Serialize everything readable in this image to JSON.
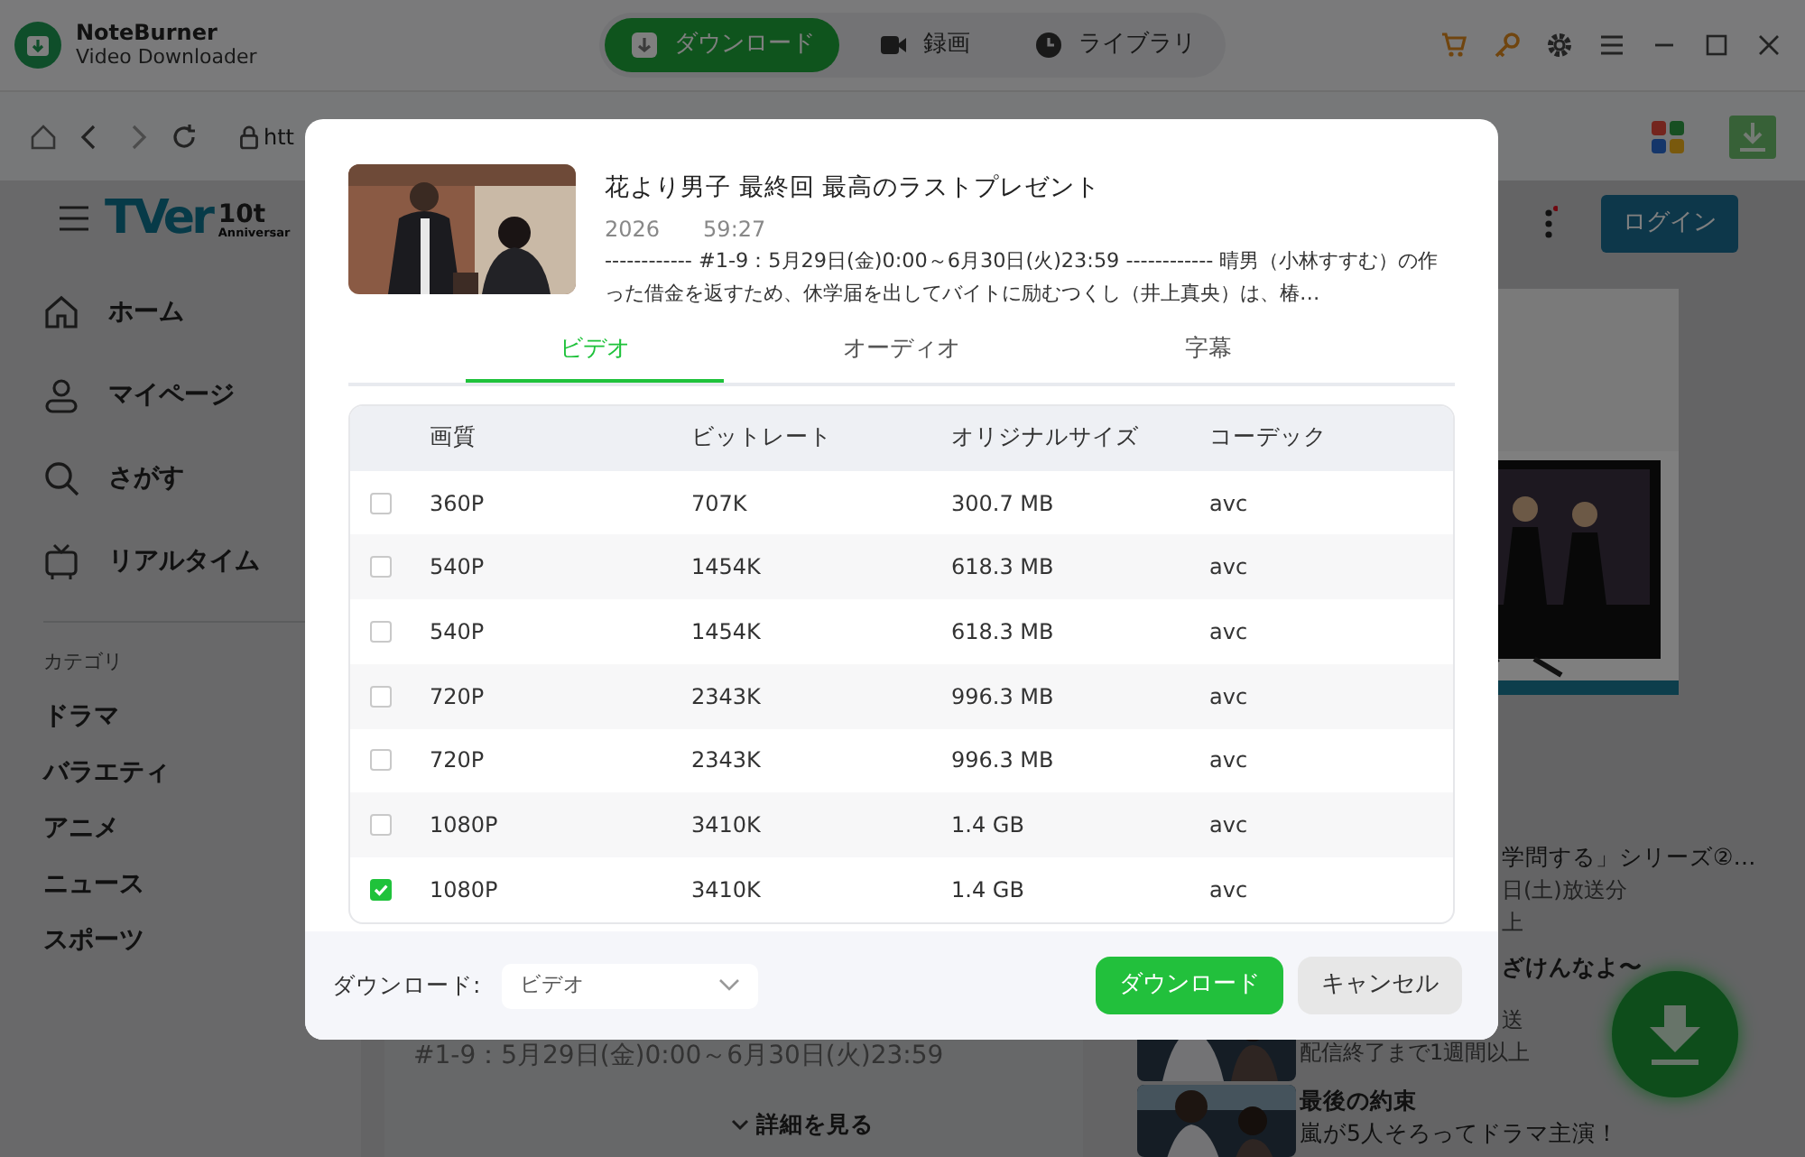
{
  "app": {
    "name": "NoteBurner",
    "subtitle": "Video Downloader",
    "tabs": [
      {
        "label": "ダウンロード",
        "selected": true
      },
      {
        "label": "録画",
        "selected": false
      },
      {
        "label": "ライブラリ",
        "selected": false
      }
    ]
  },
  "address_bar": {
    "url": "htt"
  },
  "site": {
    "logo": "TVer",
    "logo_badge": "10t",
    "logo_caption": "Anniversar",
    "nav": [
      "ホーム",
      "マイページ",
      "さがす",
      "リアルタイム"
    ],
    "category_heading": "カテゴリ",
    "categories": [
      "ドラマ",
      "バラエティ",
      "アニメ",
      "ニュース",
      "スポーツ"
    ],
    "login": "ログイン",
    "episode_period": "#1-9：5月29日(金)0:00～6月30日(火)23:59",
    "details_link": "詳細を見る",
    "side_list": [
      {
        "lines": [
          {
            "text": "学問する」シリーズ②…",
            "kind": "text"
          },
          {
            "text": "日(土)放送分",
            "kind": "note"
          },
          {
            "text": "上",
            "kind": "note"
          }
        ]
      },
      {
        "lines": [
          {
            "text": "ざけんなよ〜",
            "kind": "heading"
          },
          {
            "text": "送",
            "kind": "note"
          },
          {
            "text": "配信終了まで1週間以上",
            "kind": "note"
          }
        ]
      },
      {
        "lines": [
          {
            "text": "最後の約束",
            "kind": "heading"
          },
          {
            "text": "嵐が5人そろってドラマ主演！",
            "kind": "text"
          }
        ]
      }
    ]
  },
  "dialog": {
    "title": "花より男子 最終回 最高のラストプレゼント",
    "year": "2026",
    "duration": "59:27",
    "description": "------------ #1-9：5月29日(金)0:00～6月30日(火)23:59 ------------ 晴男（小林すすむ）の作った借金を返すため、休学届を出してバイトに励むつくし（井上真央）は、椿…",
    "tabs": [
      {
        "label": "ビデオ",
        "selected": true
      },
      {
        "label": "オーディオ",
        "selected": false
      },
      {
        "label": "字幕",
        "selected": false
      }
    ],
    "columns": [
      "画質",
      "ビットレート",
      "オリジナルサイズ",
      "コーデック"
    ],
    "rows": [
      {
        "quality": "360P",
        "bitrate": "707K",
        "size": "300.7 MB",
        "codec": "avc",
        "checked": false
      },
      {
        "quality": "540P",
        "bitrate": "1454K",
        "size": "618.3 MB",
        "codec": "avc",
        "checked": false
      },
      {
        "quality": "540P",
        "bitrate": "1454K",
        "size": "618.3 MB",
        "codec": "avc",
        "checked": false
      },
      {
        "quality": "720P",
        "bitrate": "2343K",
        "size": "996.3 MB",
        "codec": "avc",
        "checked": false
      },
      {
        "quality": "720P",
        "bitrate": "2343K",
        "size": "996.3 MB",
        "codec": "avc",
        "checked": false
      },
      {
        "quality": "1080P",
        "bitrate": "3410K",
        "size": "1.4 GB",
        "codec": "avc",
        "checked": false
      },
      {
        "quality": "1080P",
        "bitrate": "3410K",
        "size": "1.4 GB",
        "codec": "avc",
        "checked": true
      }
    ],
    "format_label": "ダウンロード:",
    "format": "ビデオ",
    "download": "ダウンロード",
    "cancel": "キャンセル"
  }
}
